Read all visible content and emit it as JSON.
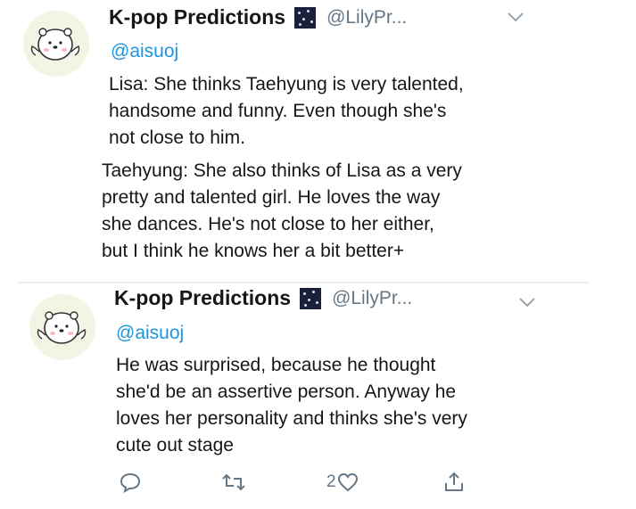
{
  "tweets": [
    {
      "display_name": "K-pop Predictions",
      "handle": "@LilyPr...",
      "reply_to": "@aisuoj",
      "paragraphs": [
        "Lisa: She thinks Taehyung is very talented,\nhandsome and funny. Even though she's\nnot close to him.",
        "Taehyung: She also thinks of Lisa as a very\npretty and talented girl. He loves the way\nshe dances. He's not close to her either,\nbut I think he knows her a bit better+"
      ]
    },
    {
      "display_name": "K-pop Predictions",
      "handle": "@LilyPr...",
      "reply_to": "@aisuoj",
      "paragraphs": [
        "He was surprised, because he thought\nshe'd be an assertive person. Anyway he\nloves her personality and thinks she's very\ncute out stage"
      ]
    }
  ],
  "actions": {
    "reply_icon": "comment-icon",
    "retweet_icon": "retweet-icon",
    "like_icon": "heart-icon",
    "like_count": "2",
    "share_icon": "share-icon"
  },
  "colors": {
    "text": "#14171a",
    "secondary": "#657786",
    "link": "#1b95e0",
    "divider": "#e6ecf0"
  }
}
